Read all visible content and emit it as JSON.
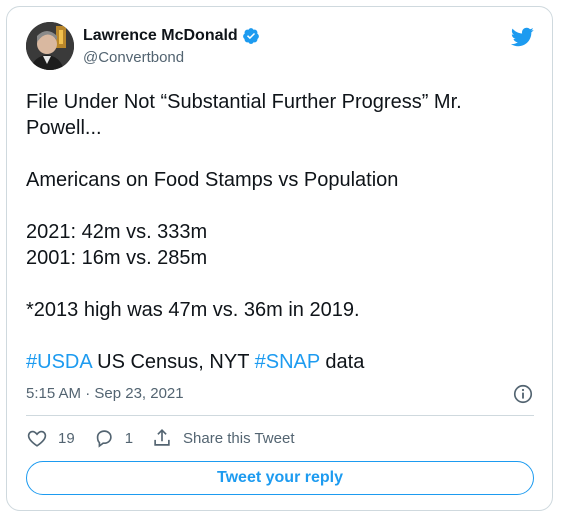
{
  "tweet": {
    "author": {
      "name": "Lawrence McDonald",
      "handle": "@Convertbond",
      "verified_icon": "verified-badge-icon"
    },
    "text": {
      "line1": "File Under Not “Substantial Further Progress” Mr.",
      "line2": "Powell...",
      "line3": "Americans on Food Stamps vs Population",
      "line4": "2021: 42m vs. 333m",
      "line5": "2001: 16m vs. 285m",
      "line6": "*2013 high was 47m vs. 36m in 2019.",
      "hashtag1": "#USDA",
      "mid_text": " US Census, NYT ",
      "hashtag2": "#SNAP",
      "end_text": " data"
    },
    "timestamp": "5:15 AM · Sep 23, 2021",
    "actions": {
      "likes": "19",
      "replies": "1",
      "share_label": "Share this Tweet"
    },
    "reply_button_label": "Tweet your reply"
  },
  "colors": {
    "accent": "#1d9bf0",
    "text": "#0f1419",
    "muted": "#536471",
    "border": "#cfd9de"
  }
}
